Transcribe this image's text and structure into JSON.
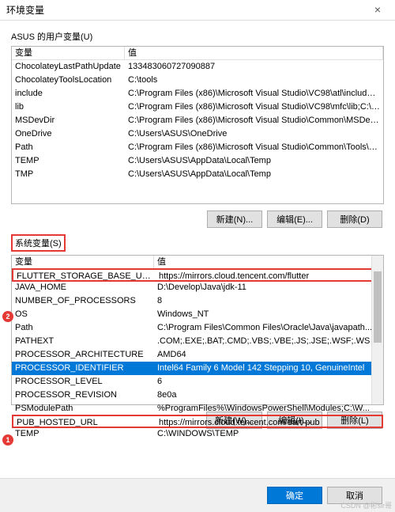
{
  "title": "环境变量",
  "sections": {
    "user_label": "ASUS 的用户变量(U)",
    "system_label": "系统变量(S)"
  },
  "headers": {
    "variable": "变量",
    "value": "值"
  },
  "user_vars": [
    {
      "name": "ChocolateyLastPathUpdate",
      "value": "133483060727090887"
    },
    {
      "name": "ChocolateyToolsLocation",
      "value": "C:\\tools"
    },
    {
      "name": "include",
      "value": "C:\\Program Files (x86)\\Microsoft Visual Studio\\VC98\\atl\\include;C:..."
    },
    {
      "name": "lib",
      "value": "C:\\Program Files (x86)\\Microsoft Visual Studio\\VC98\\mfc\\lib;C:\\Pro..."
    },
    {
      "name": "MSDevDir",
      "value": "C:\\Program Files (x86)\\Microsoft Visual Studio\\Common\\MSDev98"
    },
    {
      "name": "OneDrive",
      "value": "C:\\Users\\ASUS\\OneDrive"
    },
    {
      "name": "Path",
      "value": "C:\\Program Files (x86)\\Microsoft Visual Studio\\Common\\Tools\\Wi..."
    },
    {
      "name": "TEMP",
      "value": "C:\\Users\\ASUS\\AppData\\Local\\Temp"
    },
    {
      "name": "TMP",
      "value": "C:\\Users\\ASUS\\AppData\\Local\\Temp"
    }
  ],
  "system_vars": [
    {
      "name": "FLUTTER_STORAGE_BASE_URL",
      "value": "https://mirrors.cloud.tencent.com/flutter",
      "hl": true
    },
    {
      "name": "JAVA_HOME",
      "value": "D:\\Develop\\Java\\jdk-11"
    },
    {
      "name": "NUMBER_OF_PROCESSORS",
      "value": "8"
    },
    {
      "name": "OS",
      "value": "Windows_NT"
    },
    {
      "name": "Path",
      "value": "C:\\Program Files\\Common Files\\Oracle\\Java\\javapath..."
    },
    {
      "name": "PATHEXT",
      "value": ".COM;.EXE;.BAT;.CMD;.VBS;.VBE;.JS;.JSE;.WSF;.WSH;..."
    },
    {
      "name": "PROCESSOR_ARCHITECTURE",
      "value": "AMD64"
    },
    {
      "name": "PROCESSOR_IDENTIFIER",
      "value": "Intel64 Family 6 Model 142 Stepping 10, GenuineIntel",
      "sel": true
    },
    {
      "name": "PROCESSOR_LEVEL",
      "value": "6"
    },
    {
      "name": "PROCESSOR_REVISION",
      "value": "8e0a"
    },
    {
      "name": "PSModulePath",
      "value": "%ProgramFiles%\\WindowsPowerShell\\Modules;C:\\W..."
    },
    {
      "name": "PUB_HOSTED_URL",
      "value": "https://mirrors.cloud.tencent.com/dart-pub",
      "hl": true
    },
    {
      "name": "TEMP",
      "value": "C:\\WINDOWS\\TEMP"
    }
  ],
  "buttons": {
    "new_u": "新建(N)...",
    "edit_u": "编辑(E)...",
    "del_u": "删除(D)",
    "new_s": "新建(W)...",
    "edit_s": "编辑(I)...",
    "del_s": "删除(L)",
    "ok": "确定",
    "cancel": "取消"
  },
  "markers": {
    "m1": "1",
    "m2": "2"
  },
  "watermark": "CSDN @彬sir哥"
}
